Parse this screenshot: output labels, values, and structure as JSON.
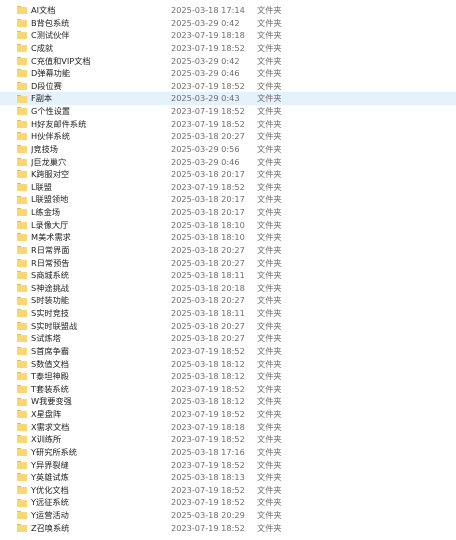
{
  "files": [
    {
      "name": "AI文档",
      "date": "2025-03-18 17:14",
      "type": "文件夹"
    },
    {
      "name": "B背包系统",
      "date": "2025-03-29 0:42",
      "type": "文件夹"
    },
    {
      "name": "C测试伙伴",
      "date": "2023-07-19 18:18",
      "type": "文件夹"
    },
    {
      "name": "C成就",
      "date": "2023-07-19 18:52",
      "type": "文件夹"
    },
    {
      "name": "C充值和VIP文档",
      "date": "2025-03-29 0:42",
      "type": "文件夹"
    },
    {
      "name": "D弹幕功能",
      "date": "2025-03-29 0:46",
      "type": "文件夹"
    },
    {
      "name": "D段位赛",
      "date": "2023-07-19 18:52",
      "type": "文件夹"
    },
    {
      "name": "F副本",
      "date": "2025-03-29 0:43",
      "type": "文件夹",
      "selected": true
    },
    {
      "name": "G个性设置",
      "date": "2023-07-19 18:52",
      "type": "文件夹"
    },
    {
      "name": "H好友邮件系统",
      "date": "2023-07-19 18:52",
      "type": "文件夹"
    },
    {
      "name": "H伙伴系统",
      "date": "2025-03-18 20:27",
      "type": "文件夹"
    },
    {
      "name": "J竞技场",
      "date": "2025-03-29 0:56",
      "type": "文件夹"
    },
    {
      "name": "J巨龙巢穴",
      "date": "2025-03-29 0:46",
      "type": "文件夹"
    },
    {
      "name": "K跨服对空",
      "date": "2025-03-18 20:17",
      "type": "文件夹"
    },
    {
      "name": "L联盟",
      "date": "2023-07-19 18:52",
      "type": "文件夹"
    },
    {
      "name": "L联盟领地",
      "date": "2025-03-18 20:17",
      "type": "文件夹"
    },
    {
      "name": "L练金场",
      "date": "2025-03-18 20:17",
      "type": "文件夹"
    },
    {
      "name": "L录像大厅",
      "date": "2025-03-18 18:10",
      "type": "文件夹"
    },
    {
      "name": "M美术需求",
      "date": "2025-03-18 18:10",
      "type": "文件夹"
    },
    {
      "name": "R日常界面",
      "date": "2025-03-18 20:27",
      "type": "文件夹"
    },
    {
      "name": "R日常预告",
      "date": "2025-03-18 20:27",
      "type": "文件夹"
    },
    {
      "name": "S商城系统",
      "date": "2025-03-18 18:11",
      "type": "文件夹"
    },
    {
      "name": "S神途挑战",
      "date": "2025-03-18 20:18",
      "type": "文件夹"
    },
    {
      "name": "S时装功能",
      "date": "2025-03-18 20:27",
      "type": "文件夹"
    },
    {
      "name": "S实时竞技",
      "date": "2025-03-18 18:11",
      "type": "文件夹"
    },
    {
      "name": "S实时联盟战",
      "date": "2025-03-18 20:27",
      "type": "文件夹"
    },
    {
      "name": "S试炼塔",
      "date": "2025-03-18 20:27",
      "type": "文件夹"
    },
    {
      "name": "S首席争霸",
      "date": "2023-07-19 18:52",
      "type": "文件夹"
    },
    {
      "name": "S数值文档",
      "date": "2025-03-18 18:12",
      "type": "文件夹"
    },
    {
      "name": "T泰坦神殿",
      "date": "2025-03-18 18:12",
      "type": "文件夹"
    },
    {
      "name": "T套装系统",
      "date": "2023-07-19 18:52",
      "type": "文件夹"
    },
    {
      "name": "W我要变强",
      "date": "2025-03-18 18:12",
      "type": "文件夹"
    },
    {
      "name": "X星盘阵",
      "date": "2023-07-19 18:52",
      "type": "文件夹"
    },
    {
      "name": "X需求文档",
      "date": "2023-07-19 18:18",
      "type": "文件夹"
    },
    {
      "name": "X训练所",
      "date": "2023-07-19 18:52",
      "type": "文件夹"
    },
    {
      "name": "Y研究所系统",
      "date": "2025-03-18 17:16",
      "type": "文件夹"
    },
    {
      "name": "Y异界裂缝",
      "date": "2023-07-19 18:52",
      "type": "文件夹"
    },
    {
      "name": "Y英雄试炼",
      "date": "2025-03-18 18:13",
      "type": "文件夹"
    },
    {
      "name": "Y优化文档",
      "date": "2023-07-19 18:52",
      "type": "文件夹"
    },
    {
      "name": "Y远征系统",
      "date": "2023-07-19 18:52",
      "type": "文件夹"
    },
    {
      "name": "Y运营活动",
      "date": "2025-03-18 20:29",
      "type": "文件夹"
    },
    {
      "name": "Z召唤系统",
      "date": "2023-07-19 18:52",
      "type": "文件夹"
    }
  ],
  "colors": {
    "folder_body": "#f8d775",
    "folder_tab": "#e8b84a",
    "selection": "#e5f1fb"
  },
  "icons": {
    "folder": "folder-icon"
  }
}
